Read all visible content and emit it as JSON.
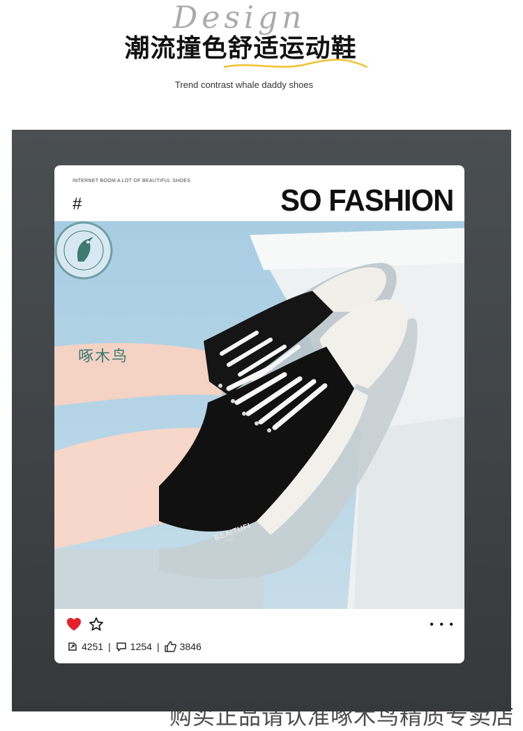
{
  "header": {
    "script_word": "Design",
    "title_cn": "潮流撞色舒适运动鞋",
    "subtitle_en": "Trend contrast whale daddy shoes"
  },
  "card": {
    "tagline": "INTERNET BOOM A LOT OF BEAUTIFUL SHOES",
    "hash": "#",
    "headline": "SO FASHION",
    "brand_badge_text": "WOODPECKER",
    "brand_name_cn": "啄木鸟",
    "shoe_label": "BEAITUFI",
    "shoe_label_sub": "TIME",
    "stats": {
      "shares": "4251",
      "comments": "1254",
      "likes": "3846"
    },
    "more": "• • •"
  },
  "footer_note": "购买正品请认准啄木鸟精质专卖店",
  "colors": {
    "panel": "#3e4245",
    "heart": "#e4202a",
    "photo_bg": "#b6d5e6",
    "brand_green": "#3e7a70",
    "accent_yellow": "#f2c12e"
  },
  "icons": [
    "heart-icon",
    "star-icon",
    "more-icon",
    "share-icon",
    "comment-icon",
    "thumbs-up-icon"
  ]
}
